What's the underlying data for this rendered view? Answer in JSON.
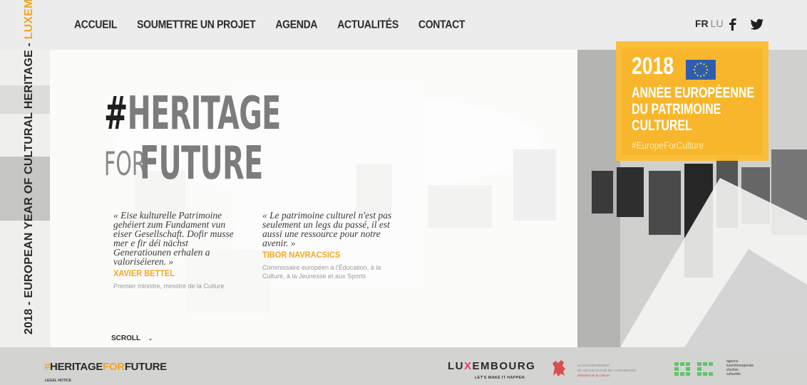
{
  "nav": {
    "items": [
      {
        "label": "ACCUEIL"
      },
      {
        "label": "SOUMETTRE UN PROJET"
      },
      {
        "label": "AGENDA"
      },
      {
        "label": "ACTUALITÉS"
      },
      {
        "label": "CONTACT"
      }
    ]
  },
  "lang": {
    "active": "FR",
    "other": "LU"
  },
  "social": {
    "icons": [
      "facebook-icon",
      "twitter-icon"
    ]
  },
  "side_text": {
    "dark": "2018 - EUROPEAN YEAR OF CULTURAL HERITAGE - ",
    "orange": "LUXEMBOURG"
  },
  "hero": {
    "hash": "#",
    "heritage": "HERITAGE",
    "for": "FOR",
    "future": "FUTURE"
  },
  "quotes": [
    {
      "text": "« Eise kulturelle Patrimoine gehéiert zum Fundament vun eiser Gesellschaft. Dofir musse mer e fir déi nächst Generatiounen erhalen a valoriséieren. »",
      "author": "XAVIER BETTEL",
      "role": "Premier ministre, ministre de la Culture"
    },
    {
      "text": "« Le patrimoine culturel n'est pas seulement un legs du passé, il est aussi une ressource pour notre avenir. »",
      "author": "TIBOR NAVRACSICS",
      "role": "Commissaire européen à l'Éducation, à la Culture, à la Jeunesse et aux Sports"
    }
  ],
  "scroll": {
    "label": "SCROLL",
    "chevron": "⌄"
  },
  "badge": {
    "year": "2018",
    "line1": "ANNÉE EUROPÉENNE",
    "line2": "DU PATRIMOINE",
    "line3": "CULTUREL",
    "tag": "#EuropeForCulture",
    "color": "#fbb219"
  },
  "footer": {
    "logo": {
      "hash": "#",
      "heritage": "HERITAGE",
      "for": "FOR",
      "future": "FUTURE"
    },
    "legal": "LEGAL NOTICE",
    "lux": {
      "pre": "LU",
      "x": "X",
      "post": "EMBOURG",
      "sub": "LET'S MAKE IT HAPPEN"
    },
    "gov": {
      "line1": "LE GOUVERNEMENT",
      "line2": "DU GRAND-DUCHÉ DE LUXEMBOURG",
      "line3": "Ministère de la Culture"
    },
    "oc": {
      "line1": "agence",
      "line2": "luxembourgeoise",
      "line3": "d'action",
      "line4": "culturelle"
    }
  },
  "colors": {
    "accent": "#f5a623",
    "text": "#2a2a2a",
    "hero_gray": "#7c7c7c"
  }
}
